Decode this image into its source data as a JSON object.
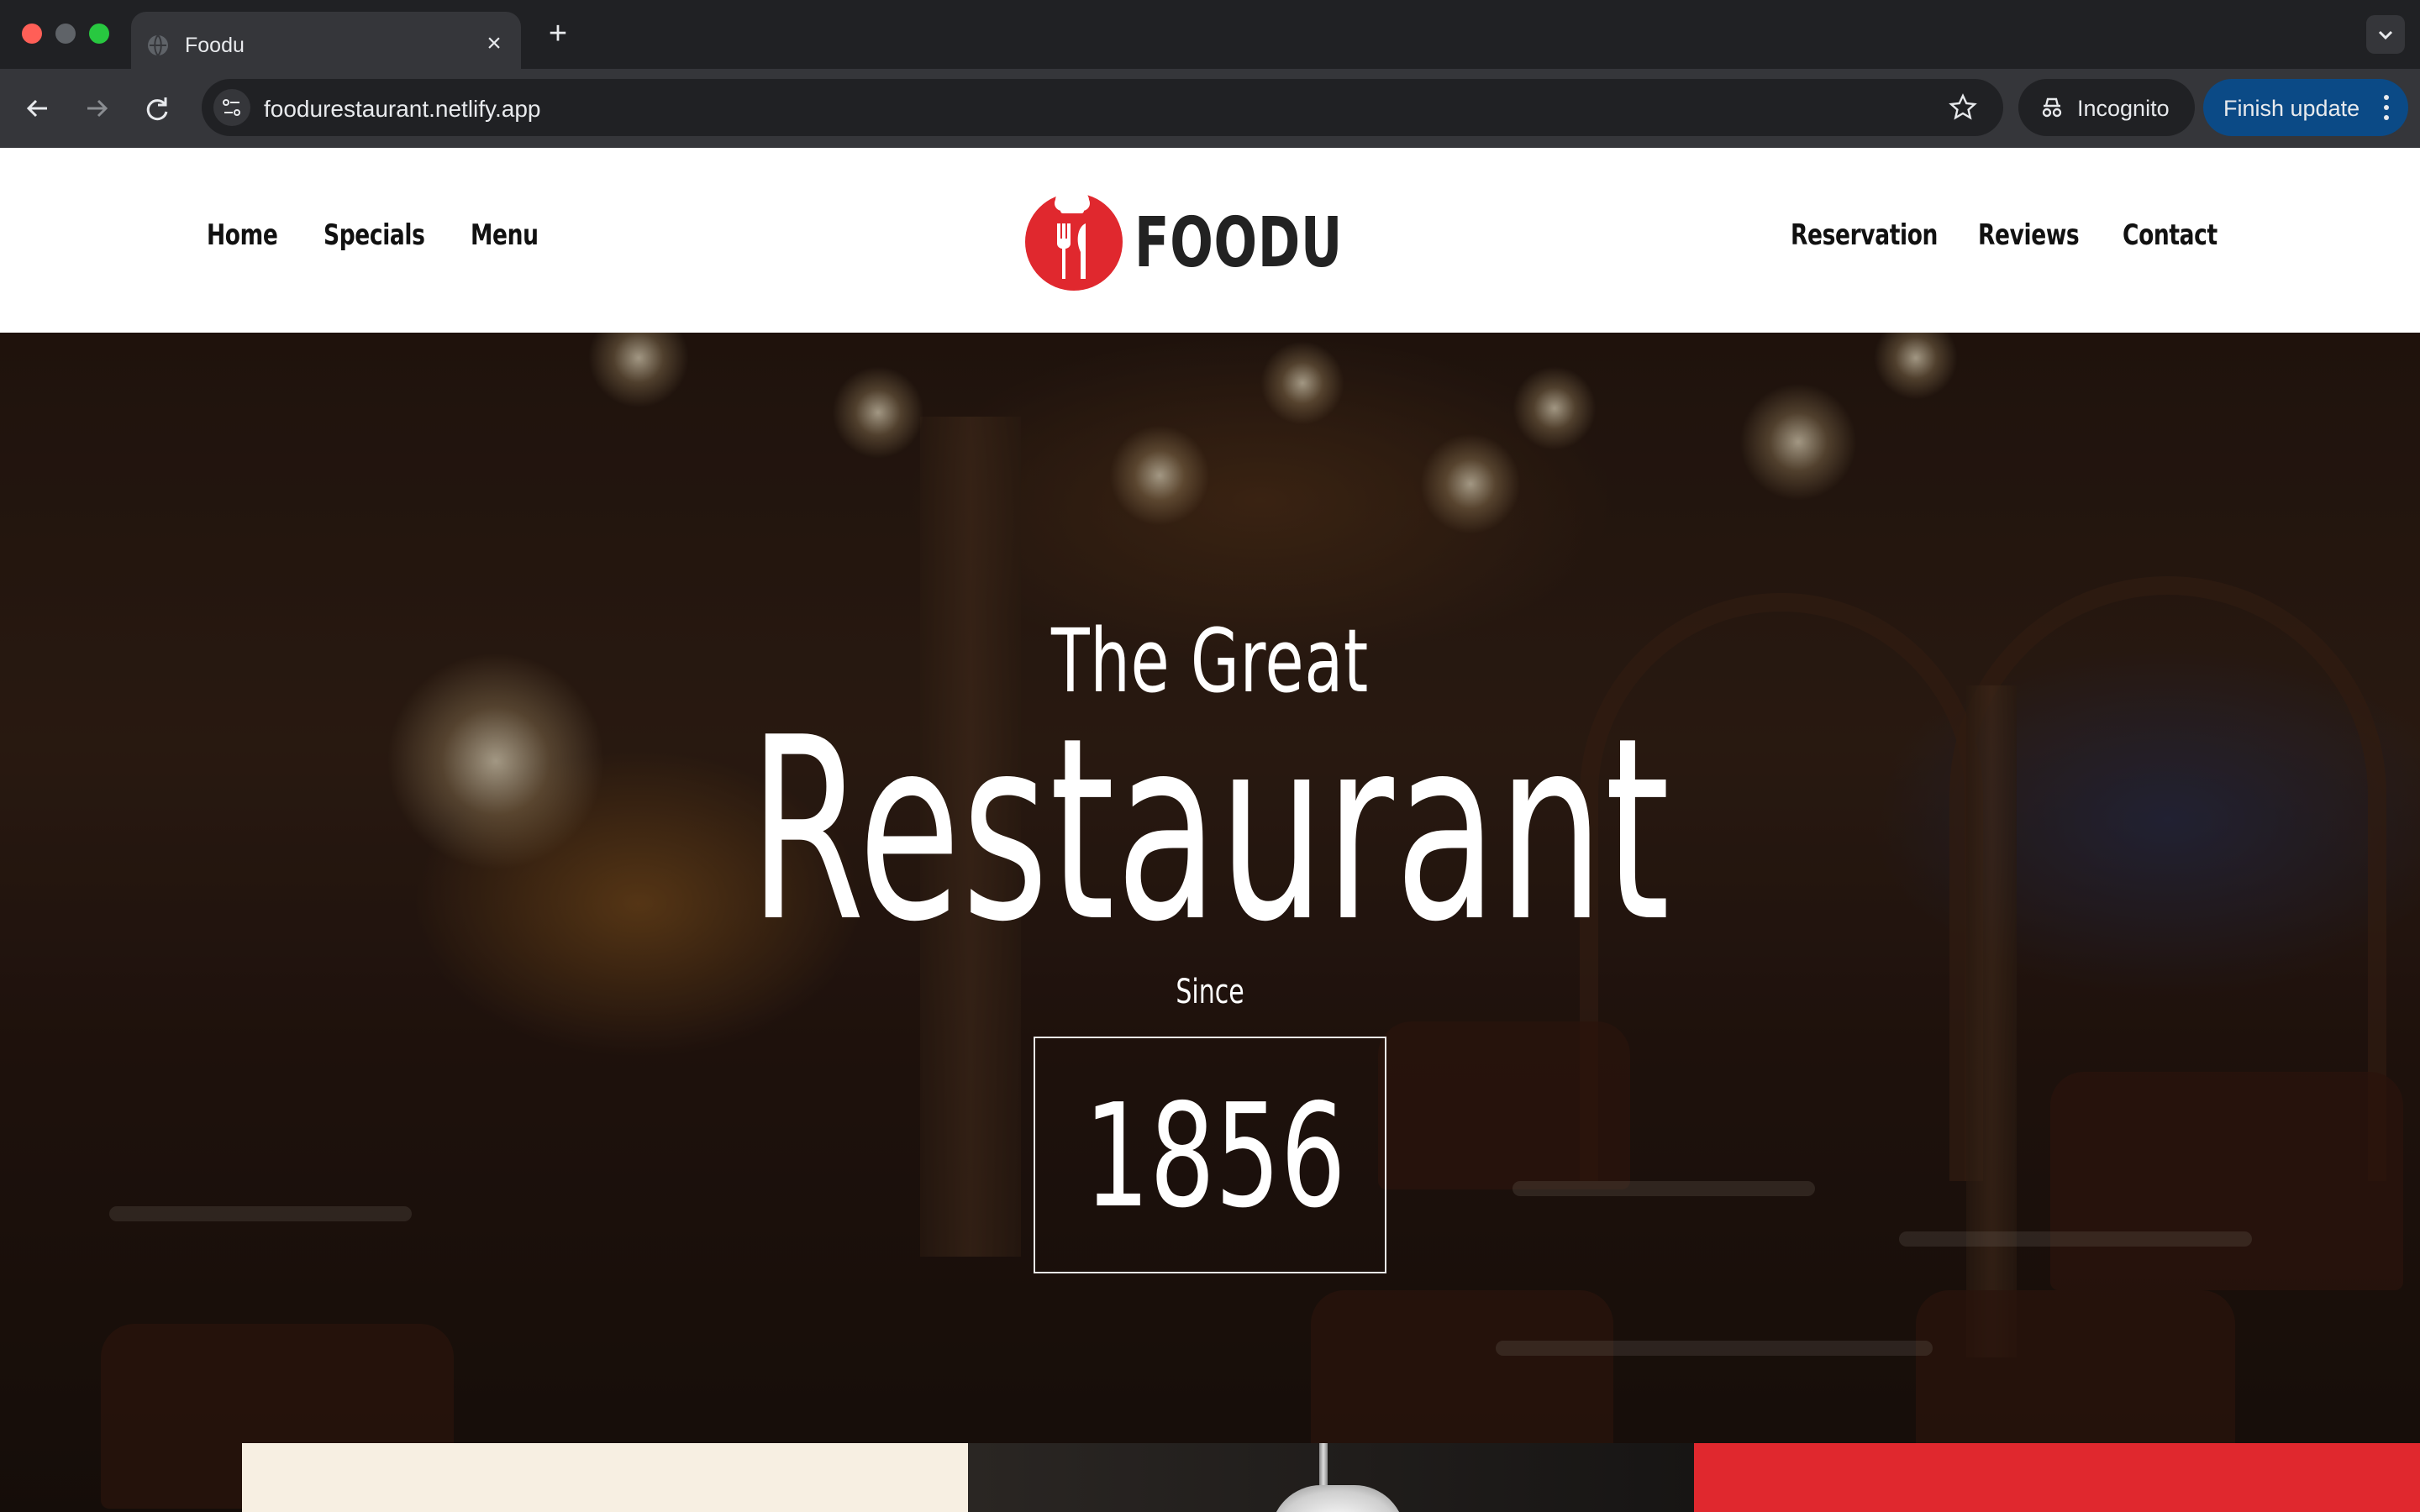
{
  "browser": {
    "tab_title": "Foodu",
    "url": "foodurestaurant.netlify.app",
    "incognito_label": "Incognito",
    "finish_update_label": "Finish update"
  },
  "site": {
    "brand": "FOODU",
    "nav_left": [
      "Home",
      "Specials",
      "Menu"
    ],
    "nav_right": [
      "Reservation",
      "Reviews",
      "Contact"
    ],
    "accent_color": "#e0282e"
  },
  "hero": {
    "eyebrow": "The Great",
    "title": "Restaurant",
    "since_label": "Since",
    "year": "1856"
  },
  "icons": {
    "tab": "globe-icon",
    "back": "arrow-left-icon",
    "forward": "arrow-right-icon",
    "reload": "reload-icon",
    "site_info": "tune-icon",
    "bookmark": "star-icon",
    "incognito": "incognito-icon",
    "menu": "kebab-icon",
    "logo": "chef-hat-cutlery-icon"
  }
}
